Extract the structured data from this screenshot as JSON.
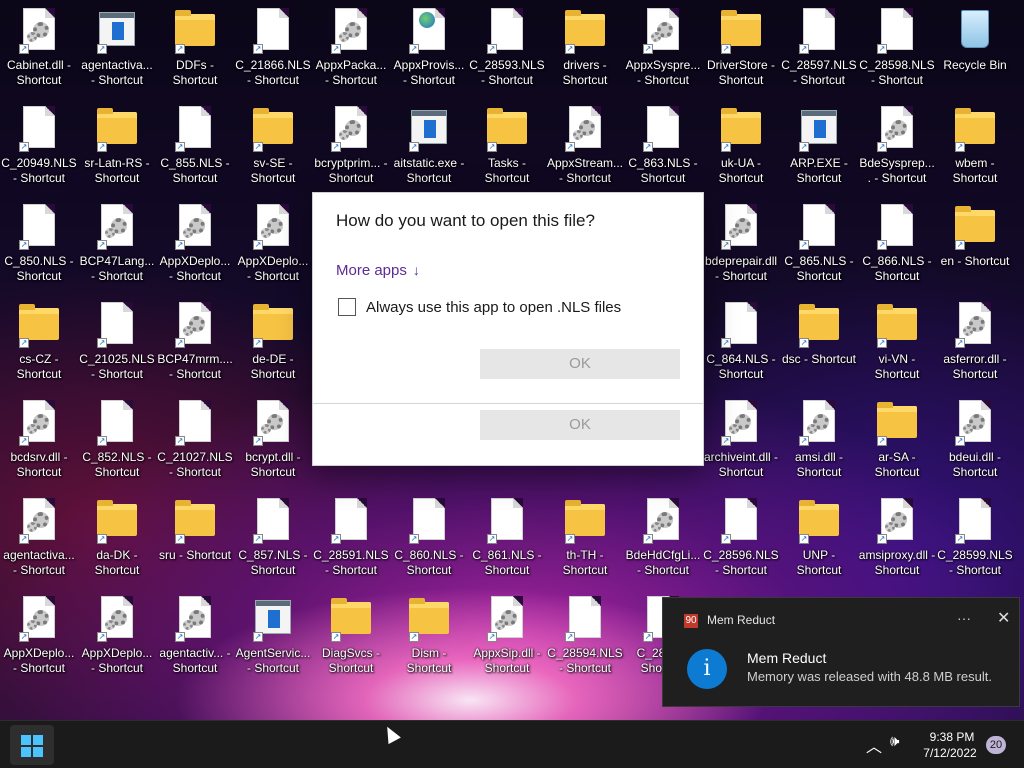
{
  "desktop": {
    "icons": [
      {
        "label": "Cabinet.dll - Shortcut",
        "type": "gear"
      },
      {
        "label": "agentactiva... - Shortcut",
        "type": "app"
      },
      {
        "label": "DDFs - Shortcut",
        "type": "folder"
      },
      {
        "label": "C_21866.NLS - Shortcut",
        "type": "doc"
      },
      {
        "label": "AppxPacka... - Shortcut",
        "type": "gear"
      },
      {
        "label": "AppxProvis... - Shortcut",
        "type": "doc-globe"
      },
      {
        "label": "C_28593.NLS - Shortcut",
        "type": "doc"
      },
      {
        "label": "drivers - Shortcut",
        "type": "folder"
      },
      {
        "label": "AppxSyspre... - Shortcut",
        "type": "gear"
      },
      {
        "label": "DriverStore - Shortcut",
        "type": "folder"
      },
      {
        "label": "C_28597.NLS - Shortcut",
        "type": "doc"
      },
      {
        "label": "C_28598.NLS - Shortcut",
        "type": "doc"
      },
      {
        "label": "Recycle Bin",
        "type": "bin"
      },
      {
        "label": "C_20949.NLS - Shortcut",
        "type": "doc"
      },
      {
        "label": "sr-Latn-RS - Shortcut",
        "type": "folder"
      },
      {
        "label": "C_855.NLS - Shortcut",
        "type": "doc"
      },
      {
        "label": "sv-SE - Shortcut",
        "type": "folder"
      },
      {
        "label": "bcryptprim... - Shortcut",
        "type": "gear"
      },
      {
        "label": "aitstatic.exe - Shortcut",
        "type": "app"
      },
      {
        "label": "Tasks - Shortcut",
        "type": "folder"
      },
      {
        "label": "AppxStream... - Shortcut",
        "type": "gear"
      },
      {
        "label": "C_863.NLS - Shortcut",
        "type": "doc"
      },
      {
        "label": "uk-UA - Shortcut",
        "type": "folder"
      },
      {
        "label": "ARP.EXE - Shortcut",
        "type": "app"
      },
      {
        "label": "BdeSysprep.... - Shortcut",
        "type": "gear"
      },
      {
        "label": "wbem - Shortcut",
        "type": "folder"
      },
      {
        "label": "C_850.NLS - Shortcut",
        "type": "doc"
      },
      {
        "label": "BCP47Lang... - Shortcut",
        "type": "gear"
      },
      {
        "label": "AppXDeplo... - Shortcut",
        "type": "gear"
      },
      {
        "label": "AppXDeplo... - Shortcut",
        "type": "gear"
      },
      {
        "label": "bdeprepair.dll - Shortcut",
        "type": "gear"
      },
      {
        "label": "C_865.NLS - Shortcut",
        "type": "doc"
      },
      {
        "label": "C_866.NLS - Shortcut",
        "type": "doc"
      },
      {
        "label": "en - Shortcut",
        "type": "folder"
      },
      {
        "label": "cs-CZ - Shortcut",
        "type": "folder"
      },
      {
        "label": "C_21025.NLS - Shortcut",
        "type": "doc"
      },
      {
        "label": "BCP47mrm.... - Shortcut",
        "type": "gear"
      },
      {
        "label": "de-DE - Shortcut",
        "type": "folder"
      },
      {
        "label": "C_864.NLS - Shortcut",
        "type": "doc"
      },
      {
        "label": "dsc - Shortcut",
        "type": "folder"
      },
      {
        "label": "vi-VN - Shortcut",
        "type": "folder"
      },
      {
        "label": "asferror.dll - Shortcut",
        "type": "gear"
      },
      {
        "label": "bcdsrv.dll - Shortcut",
        "type": "gear"
      },
      {
        "label": "C_852.NLS - Shortcut",
        "type": "doc"
      },
      {
        "label": "C_21027.NLS - Shortcut",
        "type": "doc"
      },
      {
        "label": "bcrypt.dll - Shortcut",
        "type": "gear"
      },
      {
        "label": "Shortcut",
        "type": "none"
      },
      {
        "label": "- Shortcut",
        "type": "none"
      },
      {
        "label": "- Shortcut",
        "type": "none"
      },
      {
        "label": "Shortcut",
        "type": "none"
      },
      {
        "label": "Shortcut",
        "type": "none"
      },
      {
        "label": "archiveint.dll - Shortcut",
        "type": "gear"
      },
      {
        "label": "amsi.dll - Shortcut",
        "type": "gear"
      },
      {
        "label": "ar-SA - Shortcut",
        "type": "folder"
      },
      {
        "label": "bdeui.dll - Shortcut",
        "type": "gear"
      },
      {
        "label": "agentactiva... - Shortcut",
        "type": "gear"
      },
      {
        "label": "da-DK - Shortcut",
        "type": "folder"
      },
      {
        "label": "sru - Shortcut",
        "type": "folder"
      },
      {
        "label": "C_857.NLS - Shortcut",
        "type": "doc"
      },
      {
        "label": "C_28591.NLS - Shortcut",
        "type": "doc"
      },
      {
        "label": "C_860.NLS - Shortcut",
        "type": "doc"
      },
      {
        "label": "C_861.NLS - Shortcut",
        "type": "doc"
      },
      {
        "label": "th-TH - Shortcut",
        "type": "folder"
      },
      {
        "label": "BdeHdCfgLi... - Shortcut",
        "type": "gear"
      },
      {
        "label": "C_28596.NLS - Shortcut",
        "type": "doc"
      },
      {
        "label": "UNP - Shortcut",
        "type": "folder"
      },
      {
        "label": "amsiproxy.dll - Shortcut",
        "type": "gear"
      },
      {
        "label": "C_28599.NLS - Shortcut",
        "type": "doc"
      },
      {
        "label": "AppXDeplo... - Shortcut",
        "type": "gear"
      },
      {
        "label": "AppXDeplo... - Shortcut",
        "type": "gear"
      },
      {
        "label": "agentactiv... - Shortcut",
        "type": "gear"
      },
      {
        "label": "AgentServic... - Shortcut",
        "type": "app"
      },
      {
        "label": "DiagSvcs - Shortcut",
        "type": "folder"
      },
      {
        "label": "Dism - Shortcut",
        "type": "folder"
      },
      {
        "label": "AppxSip.dll - Shortcut",
        "type": "gear"
      },
      {
        "label": "C_28594.NLS - Shortcut",
        "type": "doc"
      },
      {
        "label": "C_285... - Shortcut",
        "type": "doc"
      }
    ]
  },
  "dialog": {
    "title": "How do you want to open this file?",
    "more_apps": "More apps",
    "more_apps_arrow": "↓",
    "always_use_label": "Always use this app to open .NLS files",
    "always_use_checked": false,
    "ok_label": "OK",
    "ok_label_2": "OK"
  },
  "notification": {
    "app_icon_text": "90",
    "app_name": "Mem Reduct",
    "more_glyph": "···",
    "close_glyph": "✕",
    "info_glyph": "i",
    "title": "Mem Reduct",
    "body": "Memory was released with 48.8 MB result."
  },
  "taskbar": {
    "tray_chevron": "︿",
    "volume_glyph": "🕪",
    "time": "9:38 PM",
    "date": "7/12/2022",
    "notification_count": "20"
  },
  "colors": {
    "link_purple": "#5e2a93",
    "folder_yellow": "#f6c343",
    "toast_bg": "#1f1f1f",
    "info_blue": "#0e7bd3",
    "taskbar_bg": "#1b1b1b",
    "start_blue": "#4cc2ff"
  }
}
